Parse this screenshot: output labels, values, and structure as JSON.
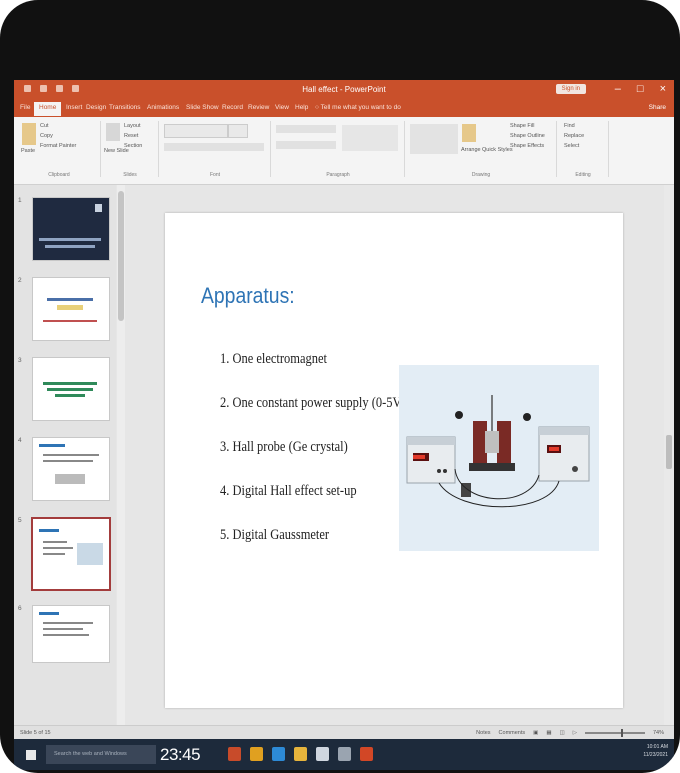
{
  "window": {
    "title": "Hall effect - PowerPoint",
    "signin_label": "Sign in",
    "controls": [
      "–",
      "□",
      "×"
    ]
  },
  "tabs": [
    "File",
    "Home",
    "Insert",
    "Design",
    "Transitions",
    "Animations",
    "Slide Show",
    "Record",
    "Review",
    "View",
    "Help",
    "Tell me what you want to do"
  ],
  "share_label": "Share",
  "ribbon": {
    "groups": [
      "Clipboard",
      "Slides",
      "Font",
      "Paragraph",
      "Drawing",
      "Editing"
    ],
    "clipboard": {
      "paste": "Paste",
      "cut": "Cut",
      "copy": "Copy",
      "format_painter": "Format Painter"
    },
    "slides": {
      "new_slide": "New Slide",
      "layout": "Layout",
      "reset": "Reset",
      "section": "Section"
    },
    "drawing": {
      "arrange": "Arrange",
      "quick_styles": "Quick Styles",
      "shape_fill": "Shape Fill",
      "shape_outline": "Shape Outline",
      "shape_effects": "Shape Effects"
    },
    "editing": {
      "find": "Find",
      "replace": "Replace",
      "select": "Select"
    }
  },
  "thumbnails": [
    {
      "num": "1"
    },
    {
      "num": "2"
    },
    {
      "num": "3"
    },
    {
      "num": "4"
    },
    {
      "num": "5",
      "selected": true
    },
    {
      "num": "6"
    }
  ],
  "slide": {
    "title": "Apparatus:",
    "items": [
      "1. One electromagnet",
      "2. One constant power supply (0-5V)",
      "3. Hall probe (Ge crystal)",
      "4. Digital Hall effect set-up",
      "5. Digital Gaussmeter"
    ]
  },
  "statusbar": {
    "slide_count": "Slide 5 of 15",
    "notes": "Notes",
    "comments": "Comments",
    "zoom": "74%"
  },
  "taskbar": {
    "search_placeholder": "Search the web and Windows",
    "clock_overlay": "23:45",
    "time": "10:01 AM",
    "date": "11/23/2021"
  },
  "colors": {
    "accent": "#c9502b",
    "title_blue": "#2e74b5",
    "taskbar": "#1d2a3b"
  }
}
